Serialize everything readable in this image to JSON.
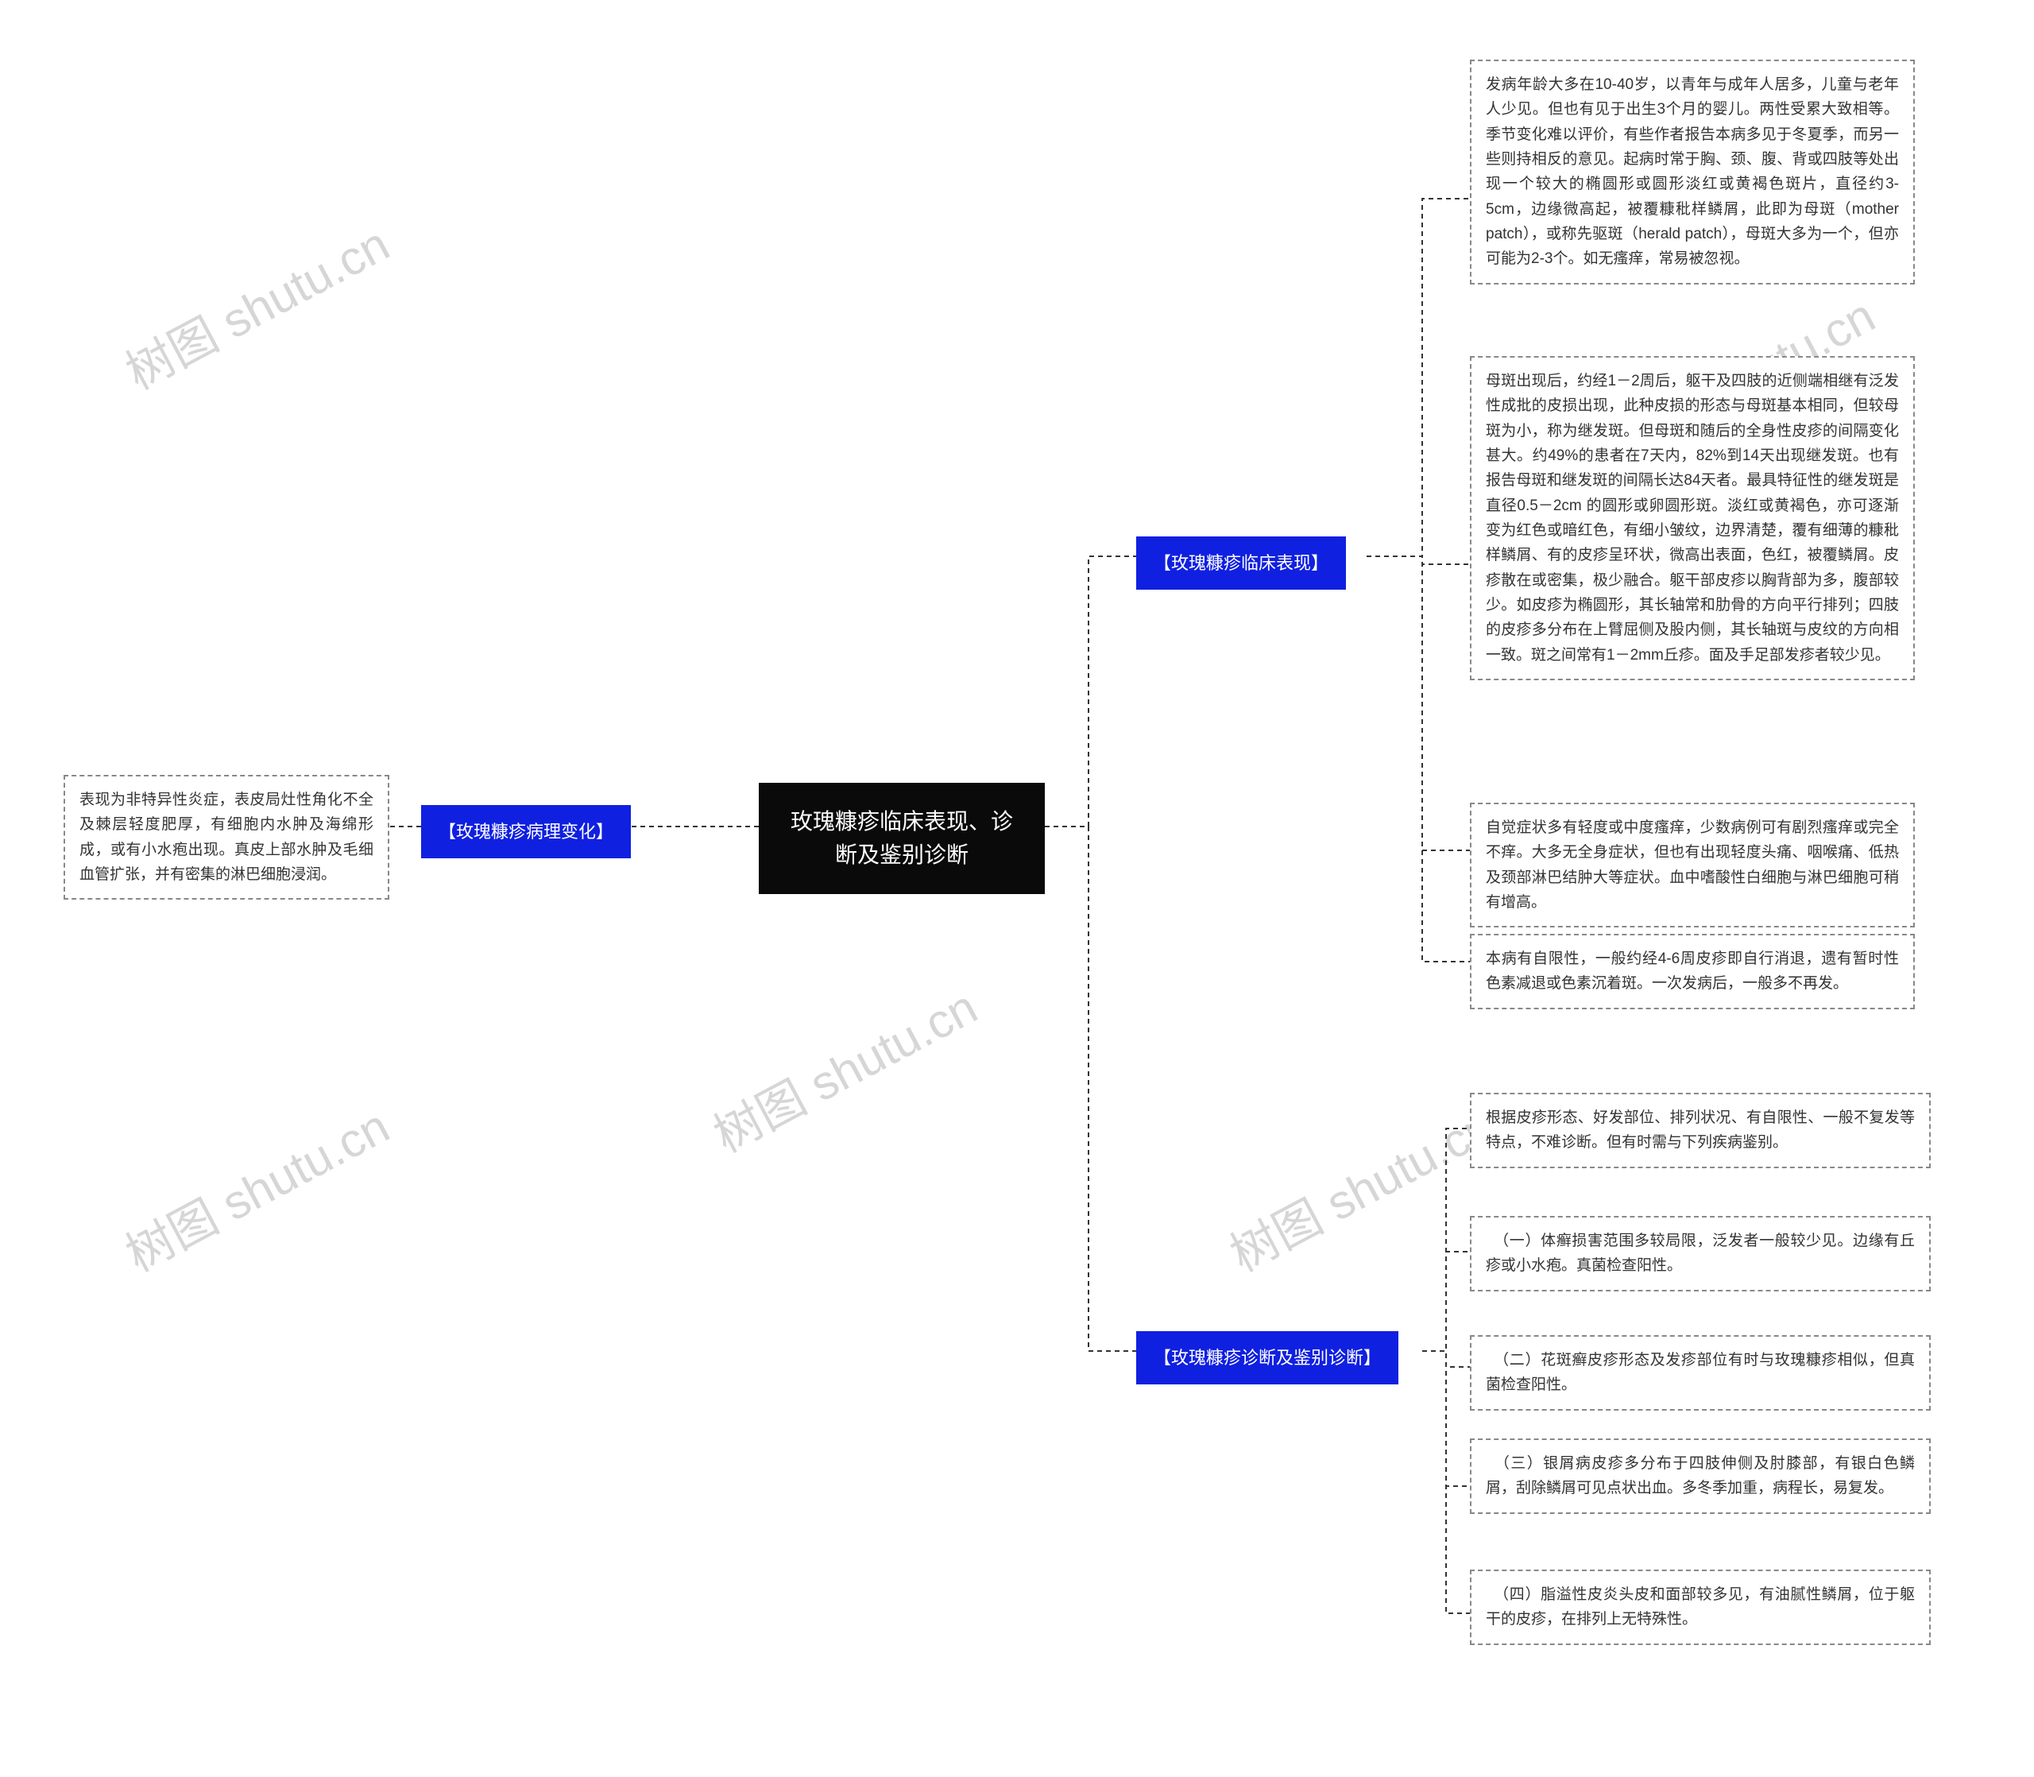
{
  "root": {
    "title": "玫瑰糠疹临床表现、诊断及鉴别诊断"
  },
  "left_branch": {
    "label": "【玫瑰糠疹病理变化】",
    "leaf": "表现为非特异性炎症，表皮局灶性角化不全及棘层轻度肥厚，有细胞内水肿及海绵形成，或有小水疱出现。真皮上部水肿及毛细血管扩张，并有密集的淋巴细胞浸润。"
  },
  "right_branches": [
    {
      "label": "【玫瑰糠疹临床表现】",
      "leaves": [
        "发病年龄大多在10-40岁，以青年与成年人居多，儿童与老年人少见。但也有见于出生3个月的婴儿。两性受累大致相等。季节变化难以评价，有些作者报告本病多见于冬夏季，而另一些则持相反的意见。起病时常于胸、颈、腹、背或四肢等处出现一个较大的椭圆形或圆形淡红或黄褐色斑片，直径约3-5cm，边缘微高起，被覆糠秕样鳞屑，此即为母斑（mother patch），或称先驱斑（herald patch），母斑大多为一个，但亦可能为2-3个。如无瘙痒，常易被忽视。",
        "母斑出现后，约经1－2周后，躯干及四肢的近侧端相继有泛发性成批的皮损出现，此种皮损的形态与母斑基本相同，但较母斑为小，称为继发斑。但母斑和随后的全身性皮疹的间隔变化甚大。约49%的患者在7天内，82%到14天出现继发斑。也有报告母斑和继发斑的间隔长达84天者。最具特征性的继发斑是直径0.5－2cm 的圆形或卵圆形斑。淡红或黄褐色，亦可逐渐变为红色或暗红色，有细小皱纹，边界清楚，覆有细薄的糠秕样鳞屑、有的皮疹呈环状，微高出表面，色红，被覆鳞屑。皮疹散在或密集，极少融合。躯干部皮疹以胸背部为多，腹部较少。如皮疹为椭圆形，其长轴常和肋骨的方向平行排列；四肢的皮疹多分布在上臂屈侧及股内侧，其长轴斑与皮纹的方向相一致。斑之间常有1－2mm丘疹。面及手足部发疹者较少见。",
        "自觉症状多有轻度或中度瘙痒，少数病例可有剧烈瘙痒或完全不痒。大多无全身症状，但也有出现轻度头痛、咽喉痛、低热及颈部淋巴结肿大等症状。血中嗜酸性白细胞与淋巴细胞可稍有增高。",
        "本病有自限性，一般约经4-6周皮疹即自行消退，遗有暂时性色素减退或色素沉着斑。一次发病后，一般多不再发。"
      ]
    },
    {
      "label": "【玫瑰糠疹诊断及鉴别诊断】",
      "leaves": [
        "根据皮疹形态、好发部位、排列状况、有自限性、一般不复发等特点，不难诊断。但有时需与下列疾病鉴别。",
        "　（一）体癣损害范围多较局限，泛发者一般较少见。边缘有丘疹或小水疱。真菌检查阳性。",
        "　（二）花斑癣皮疹形态及发疹部位有时与玫瑰糠疹相似，但真菌检查阳性。",
        "　（三）银屑病皮疹多分布于四肢伸侧及肘膝部，有银白色鳞屑，刮除鳞屑可见点状出血。多冬季加重，病程长，易复发。",
        "　（四）脂溢性皮炎头皮和面部较多见，有油腻性鳞屑，位于躯干的皮疹，在排列上无特殊性。"
      ]
    }
  ],
  "watermark_text": "树图 shutu.cn"
}
